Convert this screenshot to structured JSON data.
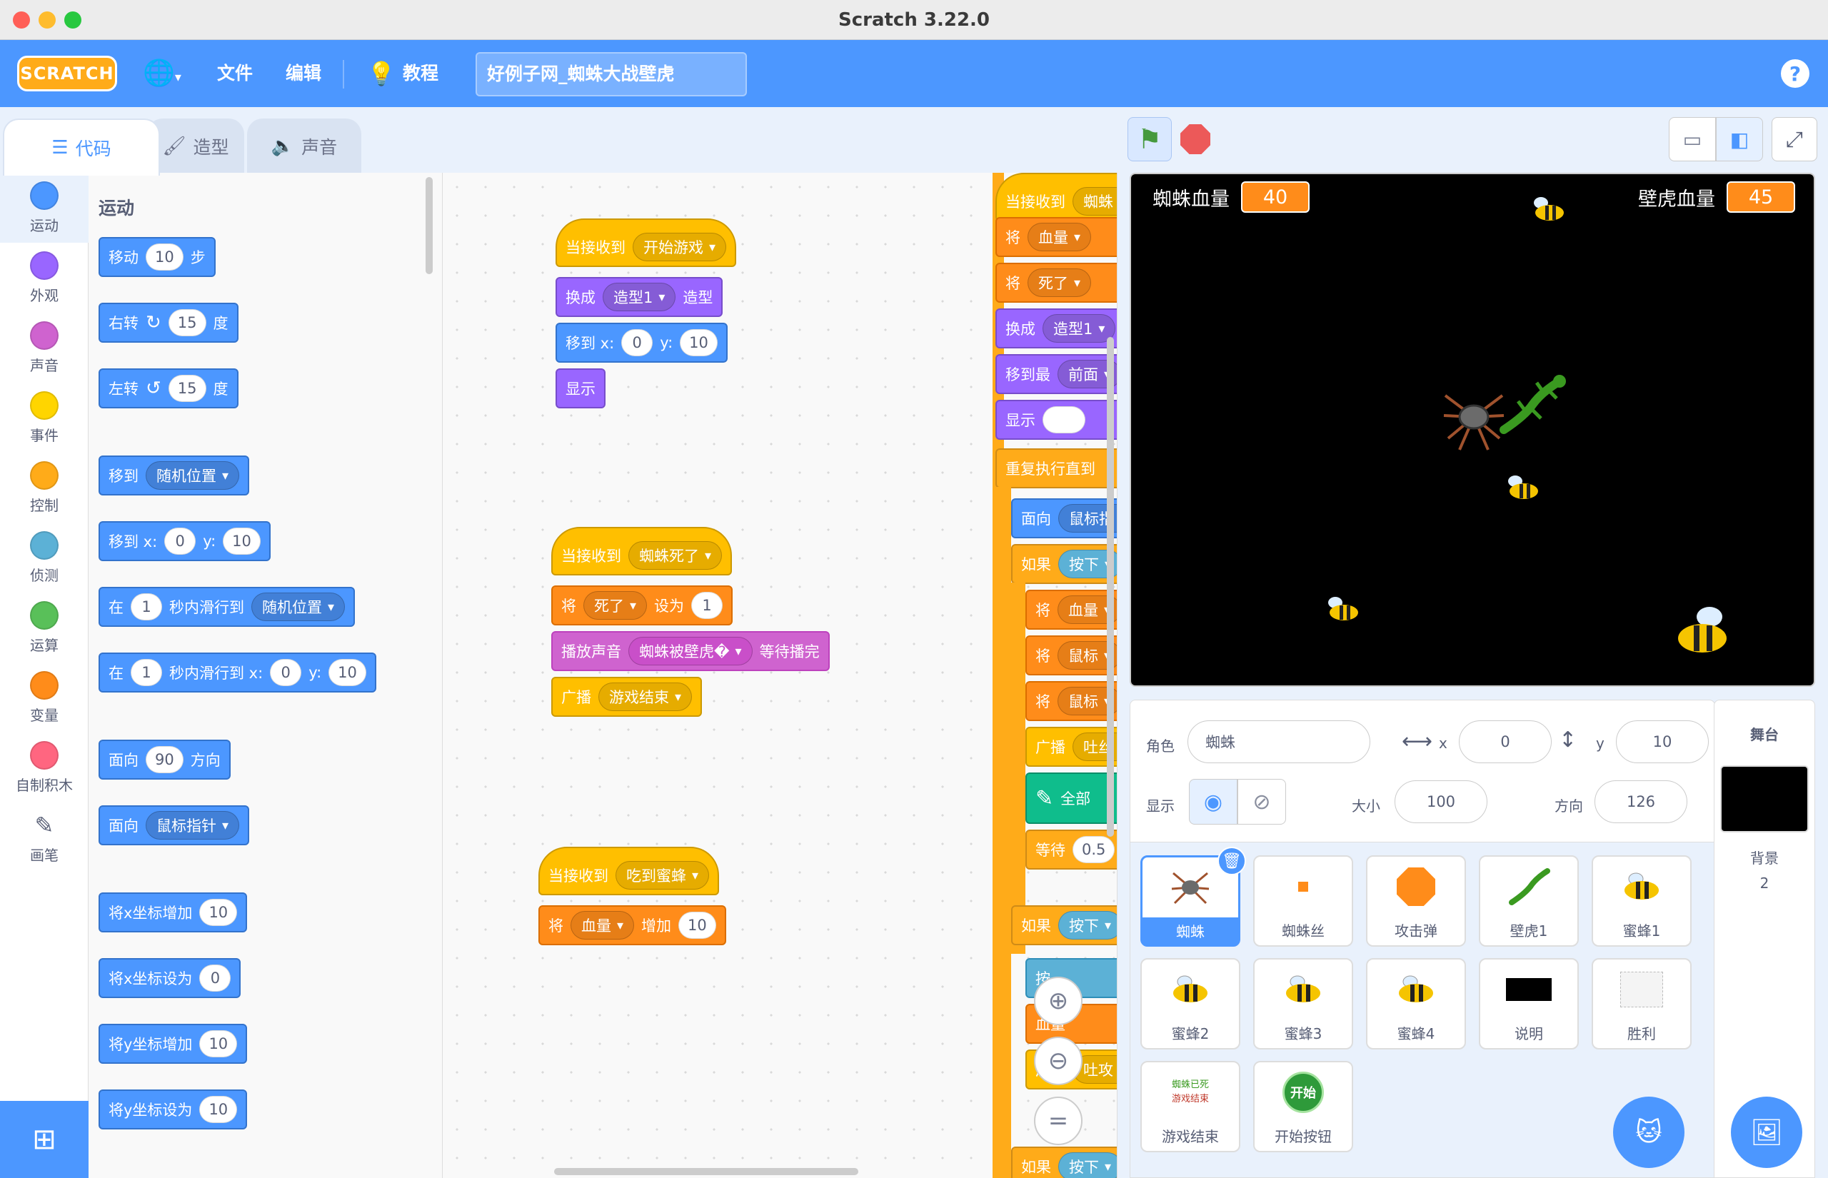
{
  "window": {
    "title": "Scratch 3.22.0"
  },
  "menu": {
    "logo": "SCRATCH",
    "globe_icon": "globe-icon",
    "file": "文件",
    "edit": "编辑",
    "tutorials": "教程",
    "project_title": "好例子网_蜘蛛大战壁虎",
    "help": "?"
  },
  "tabs": {
    "code": "代码",
    "costumes": "造型",
    "sounds": "声音"
  },
  "categories": [
    {
      "label": "运动",
      "color": "#4c97ff"
    },
    {
      "label": "外观",
      "color": "#9966ff"
    },
    {
      "label": "声音",
      "color": "#cf63cf"
    },
    {
      "label": "事件",
      "color": "#ffd500"
    },
    {
      "label": "控制",
      "color": "#ffab19"
    },
    {
      "label": "侦测",
      "color": "#5cb1d6"
    },
    {
      "label": "运算",
      "color": "#59c059"
    },
    {
      "label": "变量",
      "color": "#ff8c1a"
    },
    {
      "label": "自制积木",
      "color": "#ff6680"
    },
    {
      "label": "画笔",
      "color": ""
    }
  ],
  "palette": {
    "heading": "运动",
    "move": {
      "a": "移动",
      "n": "10",
      "b": "步"
    },
    "turn_right": {
      "a": "右转",
      "n": "15",
      "b": "度"
    },
    "turn_left": {
      "a": "左转",
      "n": "15",
      "b": "度"
    },
    "goto": {
      "a": "移到",
      "dd": "随机位置"
    },
    "goto_xy": {
      "a": "移到 x:",
      "x": "0",
      "y_label": "y:",
      "y": "10"
    },
    "glide": {
      "a": "在",
      "n": "1",
      "b": "秒内滑行到",
      "dd": "随机位置"
    },
    "glide_xy": {
      "a": "在",
      "n": "1",
      "b": "秒内滑行到 x:",
      "x": "0",
      "y_label": "y:",
      "y": "10"
    },
    "point_dir": {
      "a": "面向",
      "n": "90",
      "b": "方向"
    },
    "point_towards": {
      "a": "面向",
      "dd": "鼠标指针"
    },
    "change_x": {
      "a": "将x坐标增加",
      "n": "10"
    },
    "set_x": {
      "a": "将x坐标设为",
      "n": "0"
    },
    "change_y": {
      "a": "将y坐标增加",
      "n": "10"
    },
    "set_y": {
      "a": "将y坐标设为",
      "n": "10"
    }
  },
  "scripts": {
    "s1": {
      "hat": {
        "a": "当接收到",
        "dd": "开始游戏"
      },
      "costume": {
        "a": "换成",
        "dd": "造型1",
        "b": "造型"
      },
      "goto": {
        "a": "移到 x:",
        "x": "0",
        "y_label": "y:",
        "y": "10"
      },
      "show": "显示"
    },
    "s2": {
      "hat": {
        "a": "当接收到",
        "dd": "蜘蛛死了"
      },
      "set": {
        "a": "将",
        "dd": "死了",
        "b": "设为",
        "n": "1"
      },
      "sound": {
        "a": "播放声音",
        "dd": "蜘蛛被壁虎�",
        "b": "等待播完"
      },
      "broadcast": {
        "a": "广播",
        "dd": "游戏结束"
      }
    },
    "s3": {
      "hat": {
        "a": "当接收到",
        "dd": "吃到蜜蜂"
      },
      "change": {
        "a": "将",
        "dd": "血量",
        "b": "增加",
        "n": "10"
      }
    },
    "s4": {
      "hat": "当接收到",
      "hat_dd": "蜘蛛",
      "set1": "将",
      "set1_dd": "血量",
      "set2": "将",
      "set2_dd": "死了",
      "costume": "换成",
      "costume_dd": "造型1",
      "front": "移到最",
      "front_dd": "前面",
      "show": "显示",
      "repeat": "重复执行直到",
      "face": "面向",
      "face_dd": "鼠标指",
      "if1": "如果",
      "if1_cond": "按下",
      "c1": "将",
      "c1_dd": "血量",
      "c2": "将",
      "c2_dd": "鼠标",
      "c3": "将",
      "c3_dd": "鼠标",
      "c4": "广播",
      "c4_dd": "吐丝",
      "pen": "全部",
      "wait": "等待",
      "wait_n": "0.5",
      "if2": "如果",
      "if2_cond": "按下",
      "d1": "按",
      "d2": "血量",
      "d3": "广播",
      "d3_dd": "吐攻",
      "if3": "如果",
      "if3_cond": "按下"
    }
  },
  "stage": {
    "monitor_left": {
      "label": "蜘蛛血量",
      "value": "40"
    },
    "monitor_right": {
      "label": "壁虎血量",
      "value": "45"
    }
  },
  "sprite_info": {
    "sprite_label": "角色",
    "sprite_name": "蜘蛛",
    "x_label": "x",
    "x": "0",
    "y_label": "y",
    "y": "10",
    "show_label": "显示",
    "size_label": "大小",
    "size": "100",
    "direction_label": "方向",
    "direction": "126"
  },
  "sprites": [
    {
      "name": "蜘蛛",
      "icon": "spider-icon"
    },
    {
      "name": "蜘蛛丝",
      "icon": "silk-icon"
    },
    {
      "name": "攻击弹",
      "icon": "octagon-icon"
    },
    {
      "name": "壁虎1",
      "icon": "gecko-icon"
    },
    {
      "name": "蜜蜂1",
      "icon": "bee-icon"
    },
    {
      "name": "蜜蜂2",
      "icon": "bee-icon"
    },
    {
      "name": "蜜蜂3",
      "icon": "bee-icon"
    },
    {
      "name": "蜜蜂4",
      "icon": "bee-icon"
    },
    {
      "name": "说明",
      "icon": "instructions-icon"
    },
    {
      "name": "胜利",
      "icon": "victory-icon"
    },
    {
      "name": "游戏结束",
      "icon": "game-over-icon"
    },
    {
      "name": "开始按钮",
      "icon": "start-button-icon"
    }
  ],
  "sprite_thumbs": {
    "start_text": "开始",
    "game_over_line1": "蜘蛛已死",
    "game_over_line2": "游戏结束"
  },
  "stage_panel": {
    "title": "舞台",
    "backdrops_label": "背景",
    "backdrops_count": "2"
  }
}
